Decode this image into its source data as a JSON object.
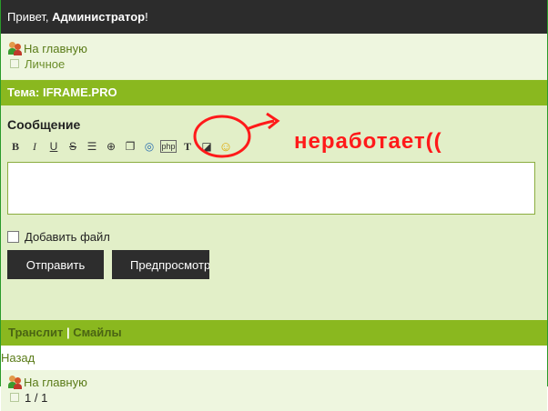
{
  "topbar": {
    "greeting": "Привет, ",
    "user": "Администратор",
    "suffix": "!"
  },
  "nav": {
    "home": "На главную",
    "personal": "Личное"
  },
  "theme": {
    "title": "Тема: IFRAME.PRO"
  },
  "form": {
    "message_label": "Сообщение",
    "toolbar": [
      {
        "name": "bold-button",
        "glyph": "B"
      },
      {
        "name": "italic-button",
        "glyph": "I"
      },
      {
        "name": "underline-button",
        "glyph": "U"
      },
      {
        "name": "strike-button",
        "glyph": "S"
      },
      {
        "name": "list-button",
        "glyph": "☰"
      },
      {
        "name": "spoiler-button",
        "glyph": "⊕"
      },
      {
        "name": "copy-button",
        "glyph": "❐"
      },
      {
        "name": "link-button",
        "glyph": "◎"
      },
      {
        "name": "php-button",
        "glyph": "php"
      },
      {
        "name": "text-color-button",
        "glyph": "T"
      },
      {
        "name": "background-color-button",
        "glyph": "◪"
      },
      {
        "name": "smiley-button",
        "glyph": "☺"
      }
    ],
    "textarea_value": "",
    "attach_label": "Добавить файл",
    "send_label": "Отправить",
    "preview_label": "Предпросмотр"
  },
  "annotation": {
    "text": "неработает(("
  },
  "footer": {
    "translit": "Транслит",
    "separator": "|",
    "smiles": "Смайлы",
    "back": "Назад",
    "home": "На главную",
    "pages": "1 / 1"
  },
  "colors": {
    "accent": "#8ab81f",
    "dark": "#2c2c2c",
    "annotation": "#ff1a1a"
  }
}
